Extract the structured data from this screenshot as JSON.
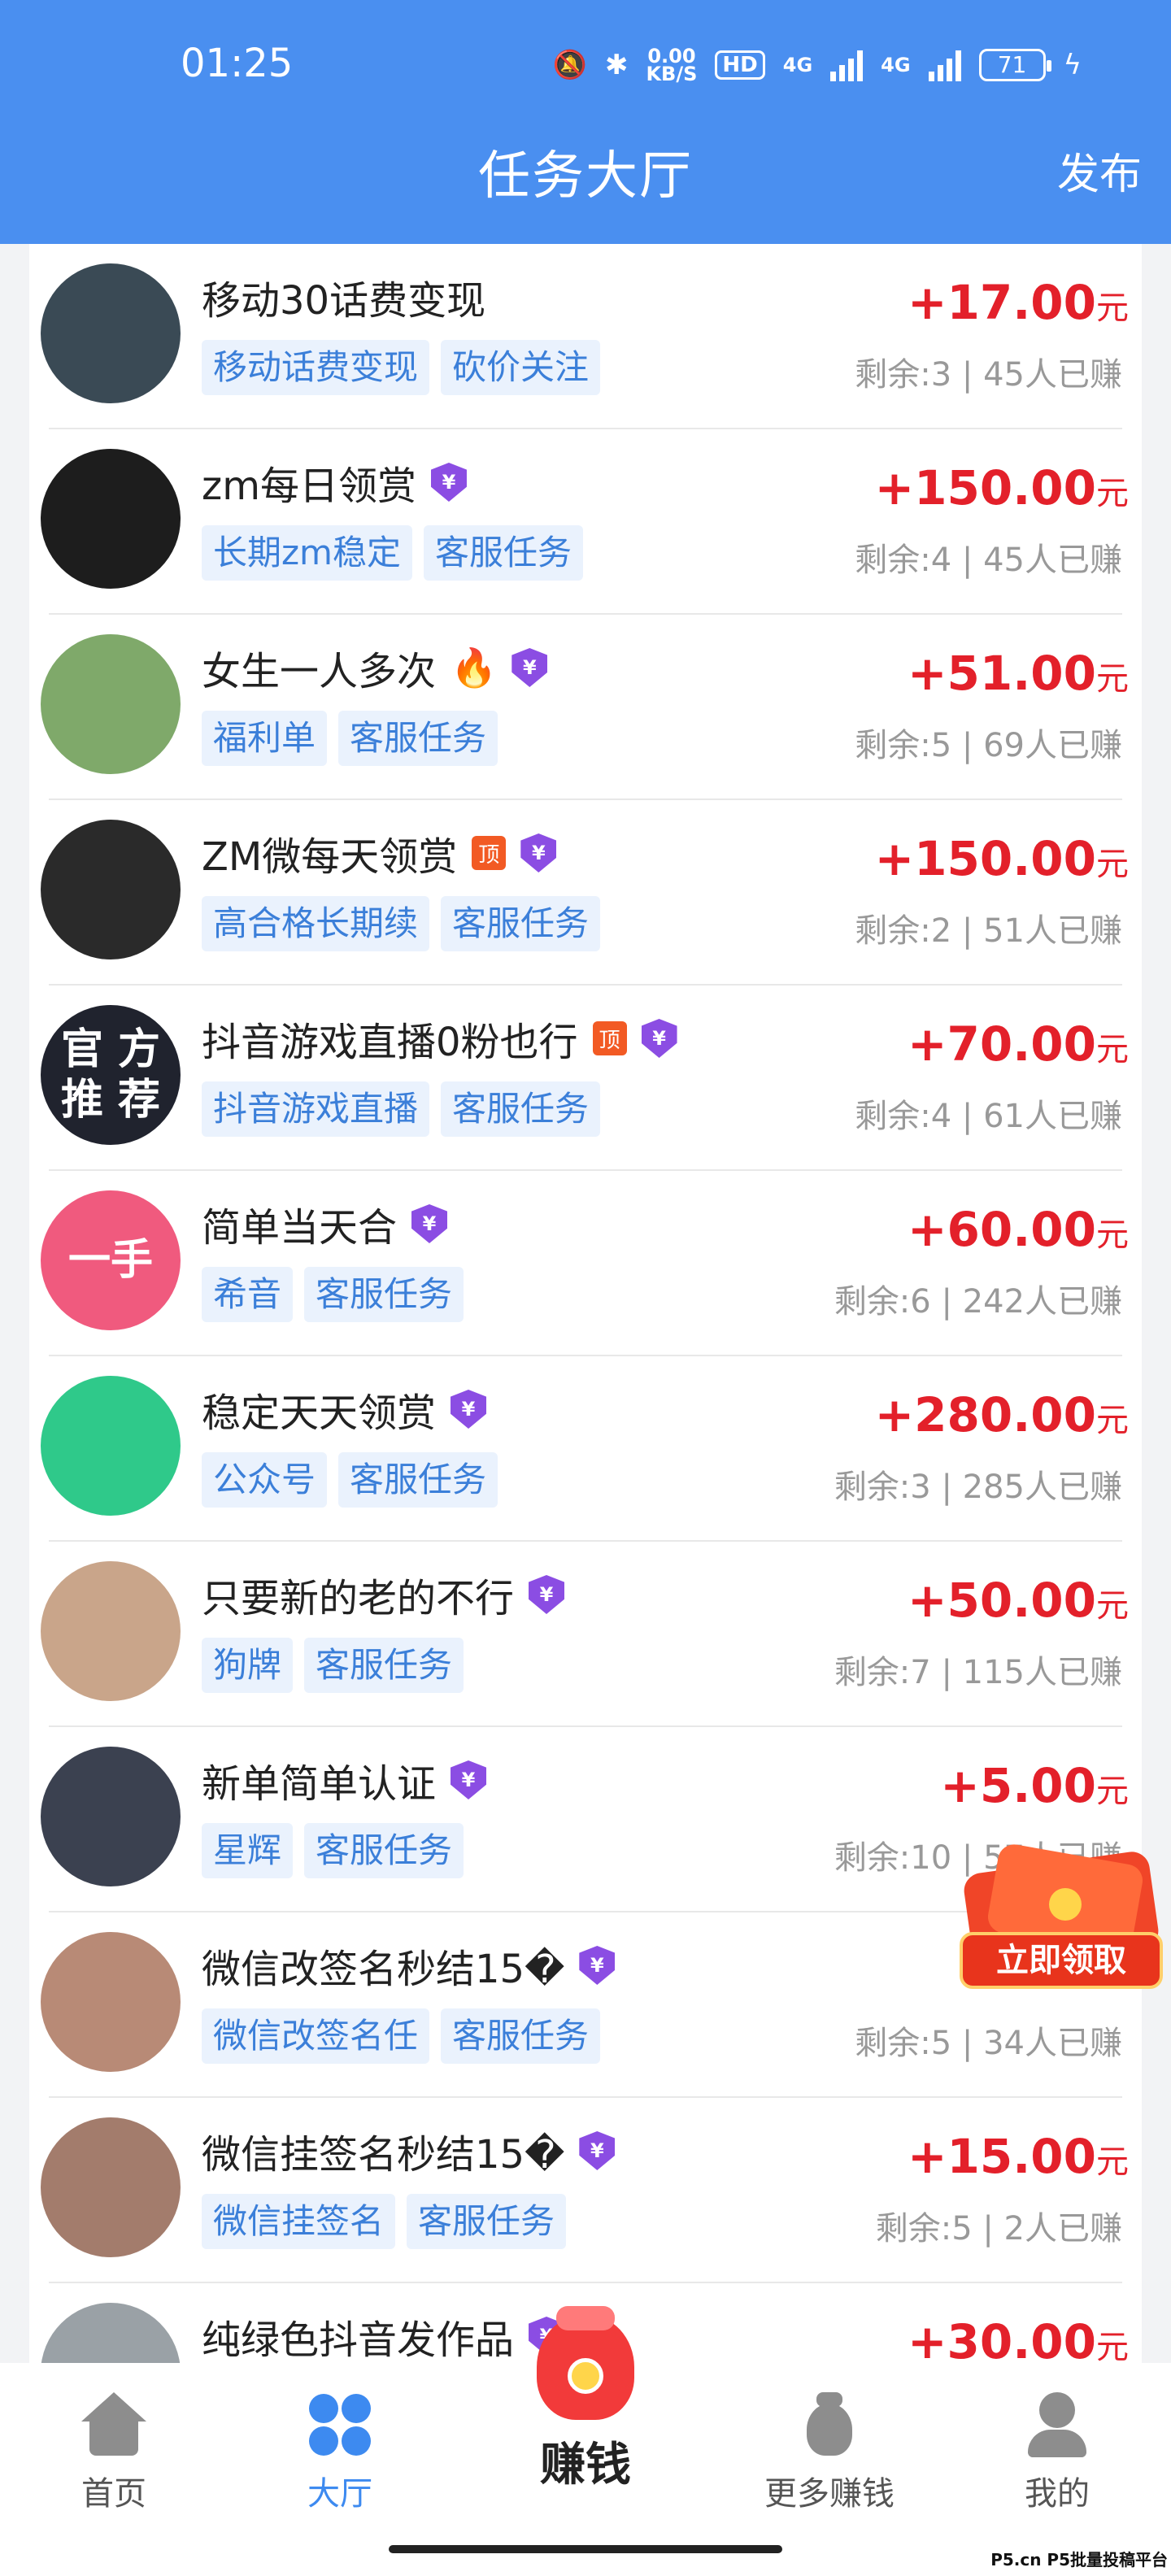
{
  "status_bar": {
    "time": "01:25",
    "net_speed_top": "0.00",
    "net_speed_bottom": "KB/S",
    "hd_label": "HD",
    "sim1_label": "4G",
    "sim2_label": "4G",
    "battery": "71"
  },
  "header": {
    "title": "任务大厅",
    "publish_label": "发布"
  },
  "tasks": [
    {
      "title": "移动30话费变现",
      "tags": [
        "移动话费变现",
        "砍价关注"
      ],
      "reward": "+17.00",
      "unit": "元",
      "meta": "剩余:3 | 45人已赚",
      "vip": false,
      "top": false,
      "avatar_color": "#3a4a55"
    },
    {
      "title": "zm每日领赏",
      "tags": [
        "长期zm稳定",
        "客服任务"
      ],
      "reward": "+150.00",
      "unit": "元",
      "meta": "剩余:4 | 45人已赚",
      "vip": true,
      "top": false,
      "avatar_color": "#1d1d1d"
    },
    {
      "title": "女生一人多次",
      "tags": [
        "福利单",
        "客服任务"
      ],
      "reward": "+51.00",
      "unit": "元",
      "meta": "剩余:5 | 69人已赚",
      "vip": true,
      "top": false,
      "fire": "🔥",
      "avatar_color": "#7fa96a"
    },
    {
      "title": "ZM微每天领赏",
      "tags": [
        "高合格长期续",
        "客服任务"
      ],
      "reward": "+150.00",
      "unit": "元",
      "meta": "剩余:2 | 51人已赚",
      "vip": true,
      "top": true,
      "top_label": "顶",
      "avatar_color": "#2a2a2a"
    },
    {
      "title": "抖音游戏直播0粉也行",
      "tags": [
        "抖音游戏直播",
        "客服任务"
      ],
      "reward": "+70.00",
      "unit": "元",
      "meta": "剩余:4 | 61人已赚",
      "vip": true,
      "top": true,
      "top_label": "顶",
      "avatar_color": "#20232e",
      "avatar_text": "官 方\n推 荐"
    },
    {
      "title": "简单当天合",
      "tags": [
        "希音",
        "客服任务"
      ],
      "reward": "+60.00",
      "unit": "元",
      "meta": "剩余:6 | 242人已赚",
      "vip": true,
      "top": false,
      "avatar_color": "#f05a7e",
      "avatar_text": "一手"
    },
    {
      "title": "稳定天天领赏",
      "tags": [
        "公众号",
        "客服任务"
      ],
      "reward": "+280.00",
      "unit": "元",
      "meta": "剩余:3 | 285人已赚",
      "vip": true,
      "top": false,
      "avatar_color": "#2fc98a"
    },
    {
      "title": "只要新的老的不行",
      "tags": [
        "狗牌",
        "客服任务"
      ],
      "reward": "+50.00",
      "unit": "元",
      "meta": "剩余:7 | 115人已赚",
      "vip": true,
      "top": false,
      "avatar_color": "#c9a58a"
    },
    {
      "title": "新单简单认证",
      "tags": [
        "星辉",
        "客服任务"
      ],
      "reward": "+5.00",
      "unit": "元",
      "meta": "剩余:10 | 57人已赚",
      "vip": true,
      "top": false,
      "avatar_color": "#3b4150"
    },
    {
      "title": "微信改签名秒结15�",
      "tags": [
        "微信改签名任",
        "客服任务"
      ],
      "reward": "+",
      "unit": "",
      "meta": "剩余:5 | 34人已赚",
      "vip": true,
      "top": false,
      "avatar_color": "#b88a76"
    },
    {
      "title": "微信挂签名秒结15�",
      "tags": [
        "微信挂签名",
        "客服任务"
      ],
      "reward": "+15.00",
      "unit": "元",
      "meta": "剩余:5 | 2人已赚",
      "vip": true,
      "top": false,
      "avatar_color": "#a37c6c"
    },
    {
      "title": "纯绿色抖音发作品",
      "tags": [],
      "reward": "+30.00",
      "unit": "元",
      "meta": "",
      "vip": true,
      "top": false,
      "avatar_color": "#9aa1a6"
    }
  ],
  "vip_symbol": "¥",
  "floating": {
    "label": "立即领取"
  },
  "bottom_nav": {
    "home": "首页",
    "hall": "大厅",
    "earn": "赚钱",
    "more": "更多赚钱",
    "me": "我的"
  },
  "watermark": "P5.cn P5批量投稿平台"
}
